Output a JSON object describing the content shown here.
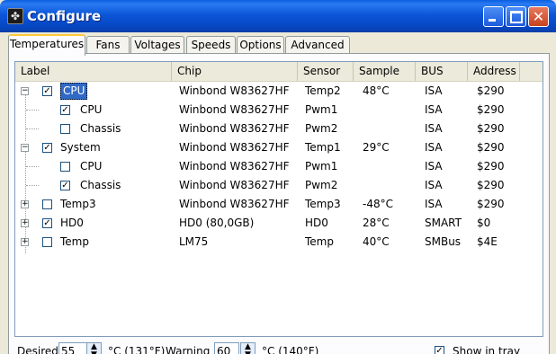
{
  "window": {
    "title": "Configure"
  },
  "tabs": [
    "Temperatures",
    "Fans",
    "Voltages",
    "Speeds",
    "Options",
    "Advanced"
  ],
  "columns": [
    "Label",
    "Chip",
    "Sensor",
    "Sample",
    "BUS",
    "Address"
  ],
  "rows": [
    {
      "label": "CPU",
      "chip": "Winbond W83627HF",
      "sensor": "Temp2",
      "sample": "48°C",
      "bus": "ISA",
      "address": "$290",
      "checked": true,
      "expander": "−",
      "selected": true
    },
    {
      "label": "CPU",
      "chip": "Winbond W83627HF",
      "sensor": "Pwm1",
      "sample": "",
      "bus": "ISA",
      "address": "$290",
      "checked": true
    },
    {
      "label": "Chassis",
      "chip": "Winbond W83627HF",
      "sensor": "Pwm2",
      "sample": "",
      "bus": "ISA",
      "address": "$290",
      "checked": false
    },
    {
      "label": "System",
      "chip": "Winbond W83627HF",
      "sensor": "Temp1",
      "sample": "29°C",
      "bus": "ISA",
      "address": "$290",
      "checked": true,
      "expander": "−"
    },
    {
      "label": "CPU",
      "chip": "Winbond W83627HF",
      "sensor": "Pwm1",
      "sample": "",
      "bus": "ISA",
      "address": "$290",
      "checked": false
    },
    {
      "label": "Chassis",
      "chip": "Winbond W83627HF",
      "sensor": "Pwm2",
      "sample": "",
      "bus": "ISA",
      "address": "$290",
      "checked": true
    },
    {
      "label": "Temp3",
      "chip": "Winbond W83627HF",
      "sensor": "Temp3",
      "sample": "-48°C",
      "bus": "ISA",
      "address": "$290",
      "checked": false,
      "expander": "+"
    },
    {
      "label": "HD0",
      "chip": "HD0 (80,0GB)",
      "sensor": "HD0",
      "sample": "28°C",
      "bus": "SMART",
      "address": "$0",
      "checked": true,
      "expander": "+"
    },
    {
      "label": "Temp",
      "chip": "LM75",
      "sensor": "Temp",
      "sample": "40°C",
      "bus": "SMBus",
      "address": "$4E",
      "checked": false,
      "expander": "+"
    }
  ],
  "bottom": {
    "desired_label": "Desired",
    "desired_value": "55",
    "desired_unit": "°C (131°F)",
    "warning_label": "Warning",
    "warning_value": "60",
    "warning_unit": "°C (140°F)",
    "show_in_tray_label": "Show in tray",
    "show_in_tray_checked": true
  }
}
